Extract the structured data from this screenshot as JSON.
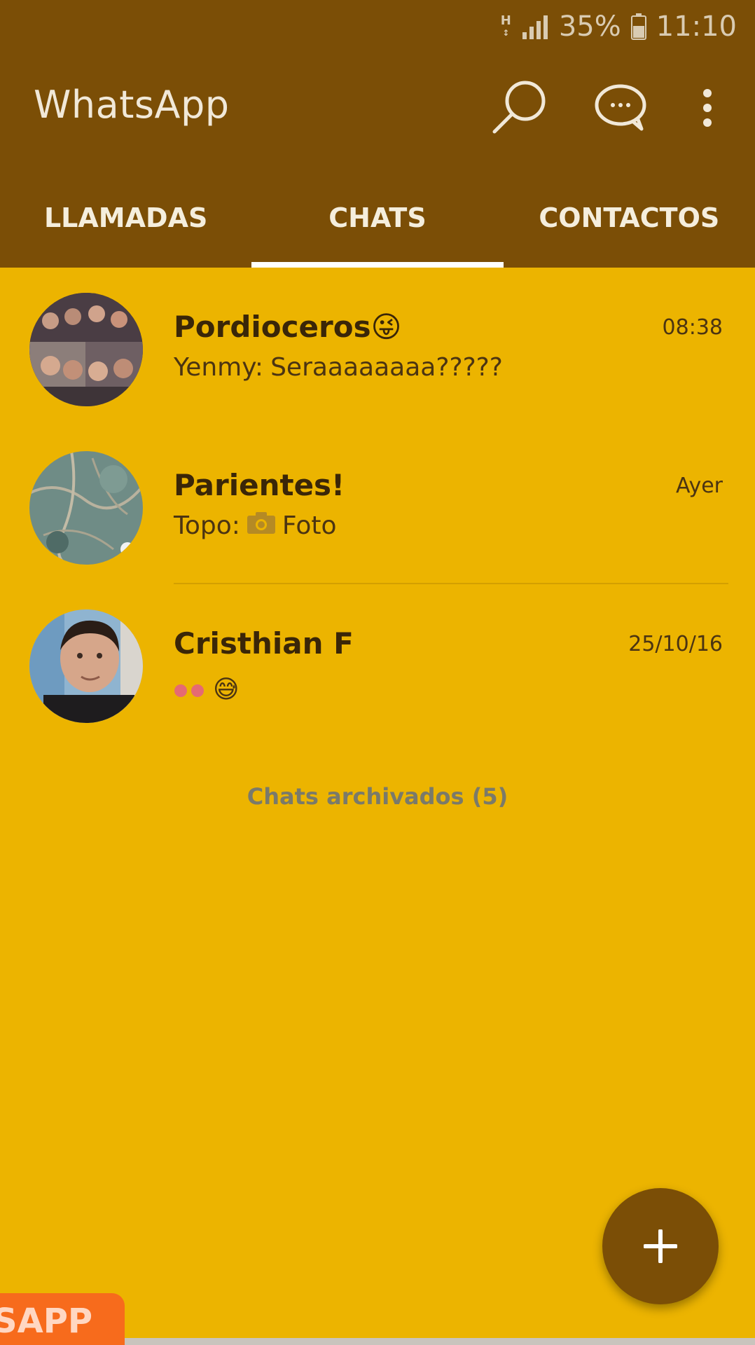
{
  "status_bar": {
    "network": "H",
    "battery_percent": "35%",
    "time": "11:10"
  },
  "header": {
    "title": "WhatsApp",
    "icons": [
      "search-icon",
      "new-chat-icon",
      "more-options-icon"
    ]
  },
  "tabs": [
    {
      "label": "LLAMADAS",
      "active": false
    },
    {
      "label": "CHATS",
      "active": true
    },
    {
      "label": "CONTACTOS",
      "active": false
    }
  ],
  "chats": [
    {
      "name": "Pordioceros",
      "name_emoji": "😜",
      "time": "08:38",
      "preview_sender": "Yenmy:",
      "preview_text": "Seraaaaaaaa?????"
    },
    {
      "name": "Parientes!",
      "time": "Ayer",
      "preview_sender": "Topo:",
      "preview_text": "Foto",
      "preview_icon": "camera-icon"
    },
    {
      "name": "Cristhian F",
      "time": "25/10/16",
      "preview_text": "😅"
    }
  ],
  "archived_label": "Chats archivados (5)",
  "fab": {
    "icon": "plus-icon"
  },
  "promo_badge": "SAPP",
  "colors": {
    "header": "#7B4E06",
    "background": "#ECB400",
    "tab_indicator": "#FFFFFF",
    "fab": "#7B4E06",
    "promo": "#F76B1C"
  }
}
